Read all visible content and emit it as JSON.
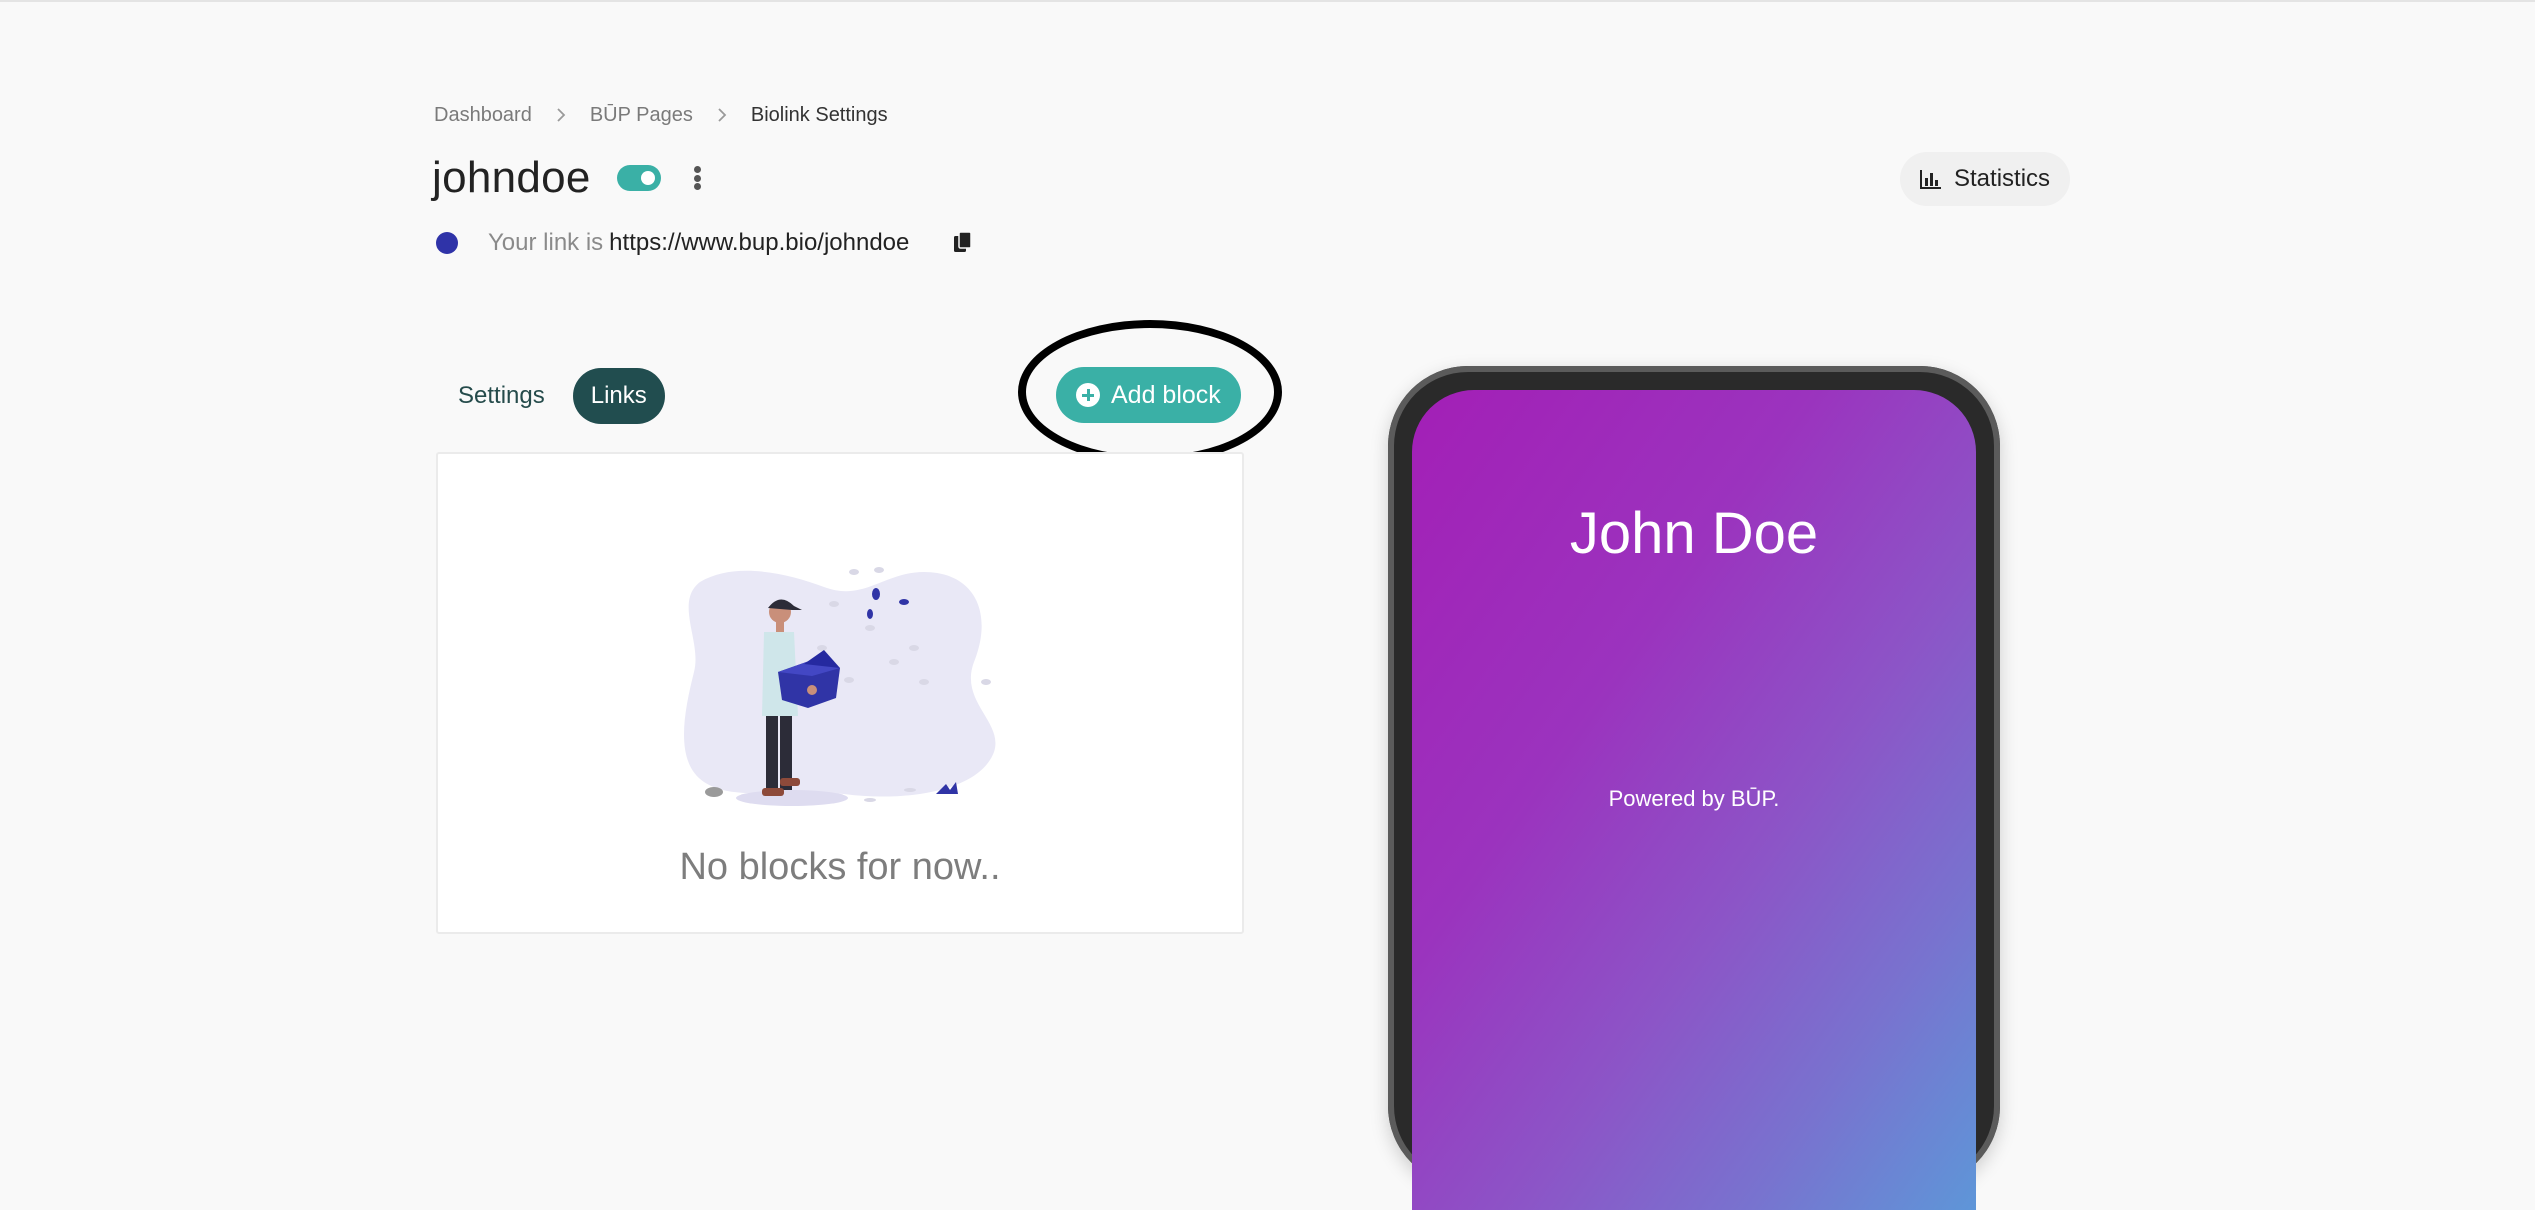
{
  "breadcrumb": {
    "items": [
      "Dashboard",
      "BŪP Pages"
    ],
    "current": "Biolink Settings"
  },
  "header": {
    "title": "johndoe",
    "toggle_on": true,
    "statistics_label": "Statistics"
  },
  "link": {
    "prefix": "Your link is",
    "url": "https://www.bup.bio/johndoe"
  },
  "tabs": [
    {
      "label": "Settings",
      "active": false
    },
    {
      "label": "Links",
      "active": true
    }
  ],
  "add_block_label": "Add block",
  "empty_state": {
    "message": "No blocks for now.."
  },
  "preview": {
    "name": "John Doe",
    "powered_by": "Powered by BŪP."
  },
  "colors": {
    "accent": "#3ab0a6",
    "active_tab": "#214d4f",
    "status_dot": "#2f33a8",
    "gradient_start": "#a31fb6",
    "gradient_end": "#5e96d8"
  }
}
